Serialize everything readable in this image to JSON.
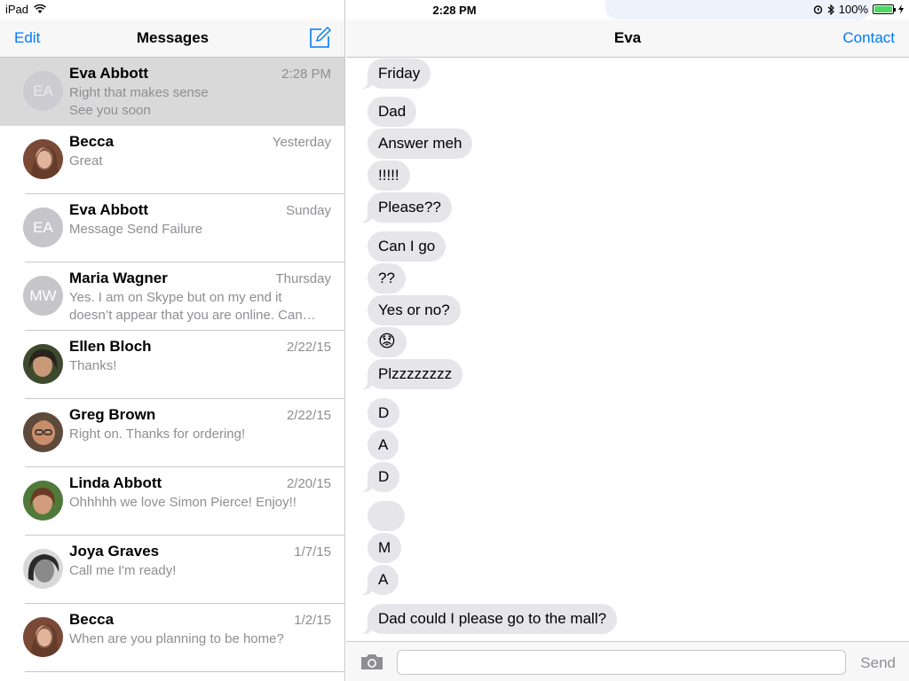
{
  "status_bar": {
    "device": "iPad",
    "time": "2:28 PM",
    "battery": "100%"
  },
  "sidebar": {
    "edit_label": "Edit",
    "title": "Messages",
    "conversations": [
      {
        "name": "Eva Abbott",
        "time": "2:28 PM",
        "line1": "Right that makes sense",
        "line2": "See you soon",
        "initials": "EA",
        "selected": true
      },
      {
        "name": "Becca",
        "time": "Yesterday",
        "line1": "Great",
        "line2": "",
        "initials": ""
      },
      {
        "name": "Eva Abbott",
        "time": "Sunday",
        "line1": "Message Send Failure",
        "line2": "",
        "initials": "EA"
      },
      {
        "name": "Maria Wagner",
        "time": "Thursday",
        "line1": "Yes. I am on Skype but on my end it",
        "line2": "doesn’t appear that you are online. Can…",
        "initials": "MW"
      },
      {
        "name": "Ellen Bloch",
        "time": "2/22/15",
        "line1": "Thanks!",
        "line2": "",
        "initials": ""
      },
      {
        "name": "Greg Brown",
        "time": "2/22/15",
        "line1": "Right on. Thanks for ordering!",
        "line2": "",
        "initials": ""
      },
      {
        "name": "Linda Abbott",
        "time": "2/20/15",
        "line1": "Ohhhhh we love Simon Pierce!  Enjoy!!",
        "line2": "",
        "initials": ""
      },
      {
        "name": "Joya Graves",
        "time": "1/7/15",
        "line1": "Call me I'm ready!",
        "line2": "",
        "initials": ""
      },
      {
        "name": "Becca",
        "time": "1/2/15",
        "line1": "When are you planning to be home?",
        "line2": "",
        "initials": ""
      }
    ]
  },
  "thread": {
    "title": "Eva",
    "contact_label": "Contact",
    "messages": [
      "Friday",
      "Dad",
      "Answer meh",
      "!!!!!",
      "Please??",
      "Can I go",
      "??",
      "Yes or no?",
      "😟",
      "Plzzzzzzzz",
      "D",
      "A",
      "D",
      "",
      "M",
      "A",
      "Dad could I please go to the mall?"
    ]
  },
  "composer": {
    "placeholder": "",
    "send_label": "Send"
  },
  "colors": {
    "accent": "#007aff",
    "bubble_received": "#e5e5ea",
    "battery": "#4cd964"
  }
}
